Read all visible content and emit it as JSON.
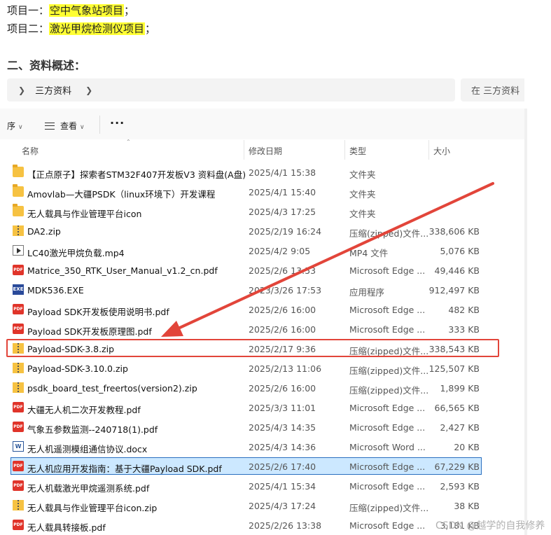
{
  "article": {
    "project1": {
      "prefix": "项目一：",
      "name": "空中气象站项目",
      "suffix": "；"
    },
    "project2": {
      "prefix": "项目二：",
      "name": "激光甲烷检测仪项目",
      "suffix": "；"
    },
    "section_title": "二、资料概述："
  },
  "explorer": {
    "address": {
      "path": "三方资料"
    },
    "search_placeholder": "在 三方资料",
    "toolbar": {
      "sort_label": "序",
      "view_label": "查看",
      "more_label": "···"
    },
    "columns": {
      "name": "名称",
      "date": "修改日期",
      "type": "类型",
      "size": "大小"
    },
    "files": [
      {
        "name": "【正点原子】探索者STM32F407开发板V3 资料盘(A盘)",
        "date": "2025/4/1 15:38",
        "type": "文件夹",
        "size": "",
        "icon": "folder-icon"
      },
      {
        "name": "Amovlab—大疆PSDK（linux环境下）开发课程",
        "date": "2025/4/1 15:40",
        "type": "文件夹",
        "size": "",
        "icon": "folder-icon"
      },
      {
        "name": "无人载具与作业管理平台icon",
        "date": "2025/4/3 17:25",
        "type": "文件夹",
        "size": "",
        "icon": "folder-icon"
      },
      {
        "name": "DA2.zip",
        "date": "2025/2/19 16:24",
        "type": "压缩(zipped)文件...",
        "size": "338,606 KB",
        "icon": "zip-icon"
      },
      {
        "name": "LC40激光甲烷负载.mp4",
        "date": "2025/4/2 9:05",
        "type": "MP4 文件",
        "size": "5,076 KB",
        "icon": "video-icon"
      },
      {
        "name": "Matrice_350_RTK_User_Manual_v1.2_cn.pdf",
        "date": "2025/2/6 13:53",
        "type": "Microsoft Edge ...",
        "size": "49,446 KB",
        "icon": "pdf-icon"
      },
      {
        "name": "MDK536.EXE",
        "date": "2023/3/26 17:53",
        "type": "应用程序",
        "size": "912,497 KB",
        "icon": "exe-icon"
      },
      {
        "name": "Payload SDK开发板使用说明书.pdf",
        "date": "2025/2/6 16:00",
        "type": "Microsoft Edge ...",
        "size": "482 KB",
        "icon": "pdf-icon"
      },
      {
        "name": "Payload SDK开发板原理图.pdf",
        "date": "2025/2/6 16:00",
        "type": "Microsoft Edge ...",
        "size": "333 KB",
        "icon": "pdf-icon"
      },
      {
        "name": "Payload-SDK-3.8.zip",
        "date": "2025/2/17 9:36",
        "type": "压缩(zipped)文件...",
        "size": "338,543 KB",
        "icon": "zip-icon"
      },
      {
        "name": "Payload-SDK-3.10.0.zip",
        "date": "2025/2/13 11:06",
        "type": "压缩(zipped)文件...",
        "size": "125,507 KB",
        "icon": "zip-icon"
      },
      {
        "name": "psdk_board_test_freertos(version2).zip",
        "date": "2025/2/6 16:00",
        "type": "压缩(zipped)文件...",
        "size": "1,899 KB",
        "icon": "zip-icon"
      },
      {
        "name": "大疆无人机二次开发教程.pdf",
        "date": "2025/3/3 11:01",
        "type": "Microsoft Edge ...",
        "size": "66,565 KB",
        "icon": "pdf-icon"
      },
      {
        "name": "气象五参数监测--240718(1).pdf",
        "date": "2025/4/3 14:35",
        "type": "Microsoft Edge ...",
        "size": "2,427 KB",
        "icon": "pdf-icon"
      },
      {
        "name": "无人机遥测模组通信协议.docx",
        "date": "2025/4/3 14:36",
        "type": "Microsoft Word ...",
        "size": "20 KB",
        "icon": "word-icon"
      },
      {
        "name": "无人机应用开发指南：基于大疆Payload SDK.pdf",
        "date": "2025/2/6 17:40",
        "type": "Microsoft Edge ...",
        "size": "67,229 KB",
        "icon": "pdf-icon"
      },
      {
        "name": "无人机载激光甲烷遥测系统.pdf",
        "date": "2025/4/1 15:34",
        "type": "Microsoft Edge ...",
        "size": "2,593 KB",
        "icon": "pdf-icon"
      },
      {
        "name": "无人载具与作业管理平台icon.zip",
        "date": "2025/4/3 17:24",
        "type": "压缩(zipped)文件...",
        "size": "38 KB",
        "icon": "zip-icon"
      },
      {
        "name": "无人载具转接板.pdf",
        "date": "2025/2/26 13:38",
        "type": "Microsoft Edge ...",
        "size": "3,181 KB",
        "icon": "pdf-icon"
      }
    ],
    "selected_index": 15,
    "highlighted_index": 9
  },
  "annotation": {
    "color": "#e2453a"
  },
  "watermark": "CSDN @越学的自我修养"
}
